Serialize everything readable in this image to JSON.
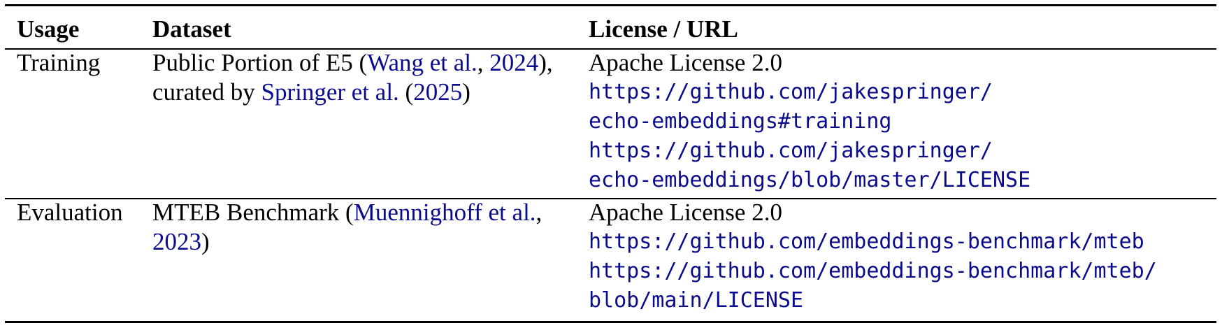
{
  "table": {
    "headers": {
      "usage": "Usage",
      "dataset": "Dataset",
      "license": "License / URL"
    },
    "rows": [
      {
        "usage": "Training",
        "dataset_line1": {
          "pre": "Public Portion of E5 (",
          "cite_name": "Wang et al.",
          "sep": ", ",
          "cite_year": "2024",
          "post": "),"
        },
        "dataset_line2": {
          "pre": "curated by ",
          "cite_name": "Springer et al.",
          "mid": " (",
          "cite_year": "2025",
          "post": ")"
        },
        "license_name": "Apache License 2.0",
        "url_lines": [
          "https://github.com/jakespringer/",
          "echo-embeddings#training",
          "https://github.com/jakespringer/",
          "echo-embeddings/blob/master/LICENSE"
        ]
      },
      {
        "usage": "Evaluation",
        "dataset_line1": {
          "pre": "MTEB Benchmark (",
          "cite_name": "Muennighoff et al.",
          "post": ","
        },
        "dataset_line2": {
          "cite_year": "2023",
          "post": ")"
        },
        "license_name": "Apache License 2.0",
        "url_lines": [
          "https://github.com/embeddings-benchmark/mteb",
          "https://github.com/embeddings-benchmark/mteb/",
          "blob/main/LICENSE"
        ]
      }
    ]
  },
  "colors": {
    "link": "#0b0c8c",
    "text": "#000000"
  }
}
